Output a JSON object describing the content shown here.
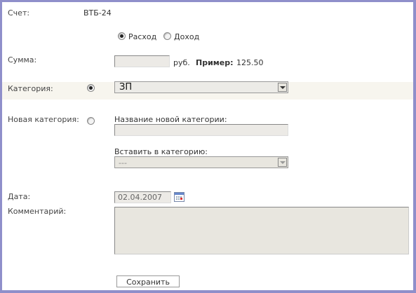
{
  "account": {
    "label": "Счет:",
    "value": "ВТБ-24"
  },
  "type": {
    "expense": "Расход",
    "income": "Доход",
    "selected": "expense"
  },
  "amount": {
    "label": "Сумма:",
    "value": "",
    "currency": "руб.",
    "example_label": "Пример:",
    "example_value": "125.50"
  },
  "category": {
    "label": "Категория:",
    "selected": "ЗП"
  },
  "new_category": {
    "label": "Новая категория:",
    "name_label": "Название новой категории:",
    "name_value": "",
    "parent_label": "Вставить в категорию:",
    "parent_selected": "---"
  },
  "date": {
    "label": "Дата:",
    "value": "02.04.2007"
  },
  "comment": {
    "label": "Комментарий:",
    "value": ""
  },
  "save_button": "Сохранить"
}
